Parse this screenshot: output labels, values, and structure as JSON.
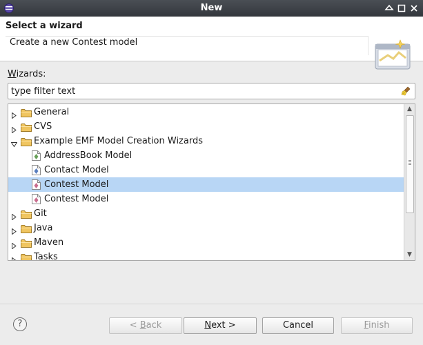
{
  "window": {
    "title": "New"
  },
  "header": {
    "title": "Select a wizard",
    "description": "Create a new Contest model"
  },
  "wizards": {
    "label_accel": "W",
    "label_rest": "izards:"
  },
  "filter": {
    "value": "type filter text",
    "placeholder": "type filter text"
  },
  "tree": {
    "items": [
      {
        "label": "General"
      },
      {
        "label": "CVS"
      },
      {
        "label": "Example EMF Model Creation Wizards"
      },
      {
        "label": "AddressBook Model"
      },
      {
        "label": "Contact Model"
      },
      {
        "label": "Contest Model"
      },
      {
        "label": "Contest Model"
      },
      {
        "label": "Git"
      },
      {
        "label": "Java"
      },
      {
        "label": "Maven"
      },
      {
        "label": "Tasks"
      }
    ]
  },
  "buttons": {
    "back_pre": "< ",
    "back_accel": "B",
    "back_rest": "ack",
    "next_accel": "N",
    "next_rest": "ext >",
    "cancel": "Cancel",
    "finish_accel": "F",
    "finish_rest": "inish"
  },
  "help": {
    "glyph": "?"
  },
  "colors": {
    "selection": "#b8d6f5",
    "title_bar": "#3c4046",
    "header_bg": "#ffffff"
  }
}
